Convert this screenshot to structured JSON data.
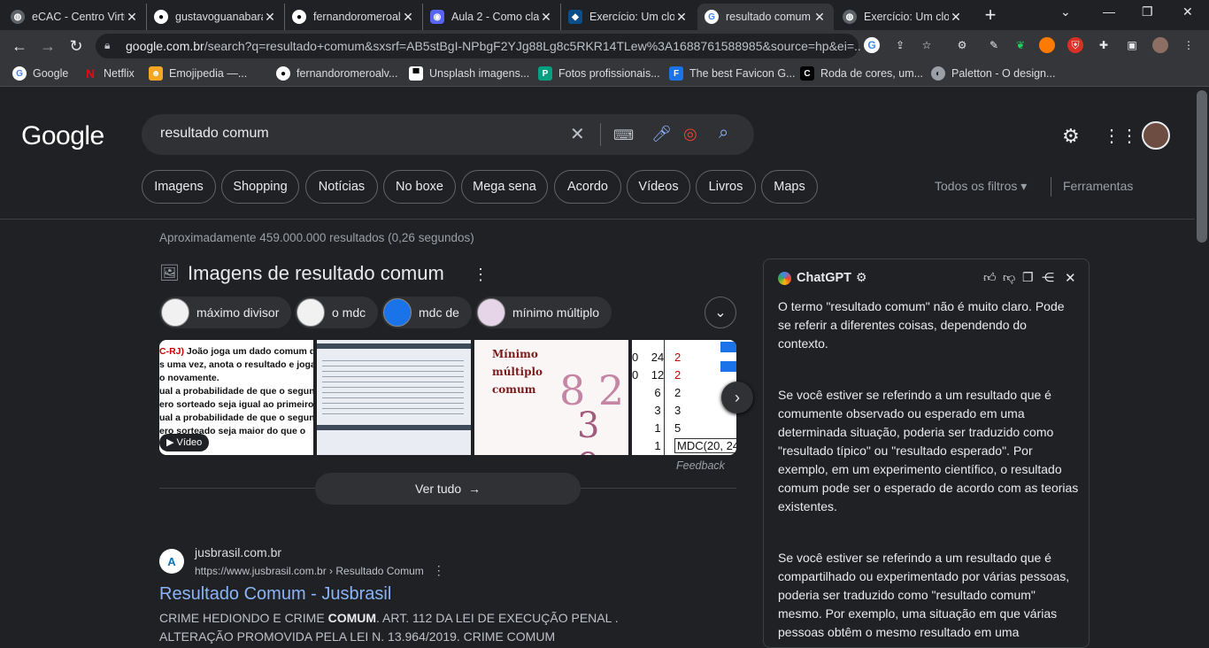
{
  "tabs": [
    {
      "title": "eCAC - Centro Virtu",
      "icon": "globe-icon"
    },
    {
      "title": "gustavoguanabara",
      "icon": "github-icon"
    },
    {
      "title": "fernandoromeroalv",
      "icon": "github-icon"
    },
    {
      "title": "Aula 2 - Como cla",
      "icon": "discord-icon"
    },
    {
      "title": "Exercício: Um clo",
      "icon": "brainly-icon"
    },
    {
      "title": "resultado comum",
      "icon": "google-icon"
    },
    {
      "title": "Exercício: Um clo",
      "icon": "globe-icon"
    }
  ],
  "address": {
    "domain": "google.com.br",
    "path": "/search?q=resultado+comum&sxsrf=AB5stBgI-NPbgF2YJg88Lg8c5RKR14TLew%3A1688761588985&source=hp&ei=..."
  },
  "bookmarks": [
    {
      "label": "Google",
      "color": "#ffffff"
    },
    {
      "label": "Netflix",
      "color": "#e50914"
    },
    {
      "label": "Emojipedia —...",
      "color": "#f5a623"
    },
    {
      "label": "fernandoromeroalv...",
      "color": "#ffffff"
    },
    {
      "label": "Unsplash imagens...",
      "color": "#ffffff"
    },
    {
      "label": "Fotos profissionais...",
      "color": "#05a081"
    },
    {
      "label": "The best Favicon G...",
      "color": "#1a73e8"
    },
    {
      "label": "Roda de cores, um...",
      "color": "#ffffff"
    },
    {
      "label": "Paletton - O design...",
      "color": "#9aa0a6"
    }
  ],
  "google": {
    "logo": "Google",
    "query": "resultado comum",
    "filters": [
      "Imagens",
      "Shopping",
      "Notícias",
      "No boxe",
      "Mega sena",
      "Acordo",
      "Vídeos",
      "Livros",
      "Maps"
    ],
    "all_filters": "Todos os filtros",
    "tools": "Ferramentas",
    "stats": "Aproximadamente 459.000.000 resultados (0,26 segundos)"
  },
  "images": {
    "title": "Imagens de resultado comum",
    "related": [
      "máximo divisor",
      "o mdc",
      "mdc de",
      "mínimo múltiplo"
    ],
    "thumb1_lines": [
      "C-RJ) João joga um dado comum de",
      "s uma vez, anota o resultado e joga",
      "o novamente.",
      "ual a probabilidade de que o segun",
      "ero sorteado seja igual ao primeiro",
      "ual a probabilidade de que o segun",
      "ero sorteado seja maior do que o"
    ],
    "video_badge": "Vídeo",
    "thumb3_title": "Mínimo múltiplo comum",
    "thumb4_rows": [
      [
        "0",
        "24",
        "2"
      ],
      [
        "0",
        "12",
        "2"
      ],
      [
        "",
        "6",
        "2"
      ],
      [
        "",
        "3",
        "3"
      ],
      [
        "",
        "1",
        "5"
      ],
      [
        "",
        "1",
        "MDC(20, 24"
      ]
    ],
    "feedback": "Feedback",
    "see_all": "Ver tudo"
  },
  "result": {
    "site": "jusbrasil.com.br",
    "url": "https://www.jusbrasil.com.br › Resultado Comum",
    "title": "Resultado Comum - Jusbrasil",
    "snippet_a": "CRIME HEDIONDO E CRIME ",
    "snippet_b": "COMUM",
    "snippet_c": ". ART. 112 DA LEI DE EXECUÇÃO PENAL .",
    "snippet_line2": "ALTERAÇÃO PROMOVIDA PELA LEI N. 13.964/2019. CRIME COMUM"
  },
  "chatgpt": {
    "title": "ChatGPT",
    "p1": "O termo \"resultado comum\" não é muito claro. Pode se referir a diferentes coisas, dependendo do contexto.",
    "p2": "Se você estiver se referindo a um resultado que é comumente observado ou esperado em uma determinada situação, poderia ser traduzido como \"resultado típico\" ou \"resultado esperado\". Por exemplo, em um experimento científico, o resultado comum pode ser o esperado de acordo com as teorias existentes.",
    "p3": "Se você estiver se referindo a um resultado que é compartilhado ou experimentado por várias pessoas, poderia ser traduzido como \"resultado comum\" mesmo. Por exemplo, uma situação em que várias pessoas obtêm o mesmo resultado em uma"
  },
  "colors": {
    "link": "#8ab4f8",
    "bg": "#202124",
    "chip_border": "#5f6368"
  }
}
